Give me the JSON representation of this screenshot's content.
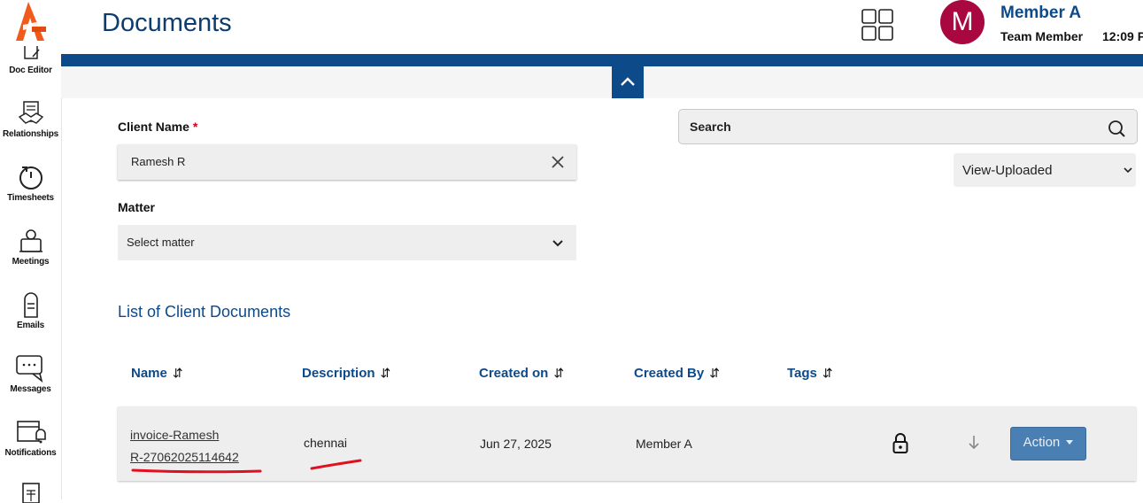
{
  "sidebar": {
    "items": [
      {
        "label": "Doc Editor",
        "icon": "doc-editor-icon"
      },
      {
        "label": "Relationships",
        "icon": "handshake-icon"
      },
      {
        "label": "Timesheets",
        "icon": "timer-icon"
      },
      {
        "label": "Meetings",
        "icon": "meeting-icon"
      },
      {
        "label": "Emails",
        "icon": "mailbox-icon"
      },
      {
        "label": "Messages",
        "icon": "chat-icon"
      },
      {
        "label": "Notifications",
        "icon": "calendar-bell-icon"
      }
    ]
  },
  "header": {
    "title": "Documents",
    "avatar_letter": "M",
    "user_name": "Member A",
    "user_role": "Team Member",
    "time": "12:09 P"
  },
  "form": {
    "client_label": "Client Name",
    "client_required": "*",
    "client_value": "Ramesh R",
    "matter_label": "Matter",
    "matter_placeholder": "Select matter",
    "search_placeholder": "Search",
    "view_select": "View-Uploaded"
  },
  "list": {
    "title": "List of Client Documents",
    "columns": [
      "Name",
      "Description",
      "Created on",
      "Created By",
      "Tags"
    ],
    "sort_glyph": "⇵",
    "rows": [
      {
        "name_line1": "invoice-Ramesh",
        "name_line2": "R-27062025114642",
        "description": "chennai",
        "created_on": "Jun 27, 2025",
        "created_by": "Member A",
        "tags": "",
        "action_label": "Action"
      }
    ]
  },
  "colors": {
    "brand_blue": "#0d4a8a",
    "avatar": "#a8073f",
    "action_button": "#4a7fb3",
    "annotation_red": "#e01020",
    "logo_orange": "#f05a1a"
  }
}
